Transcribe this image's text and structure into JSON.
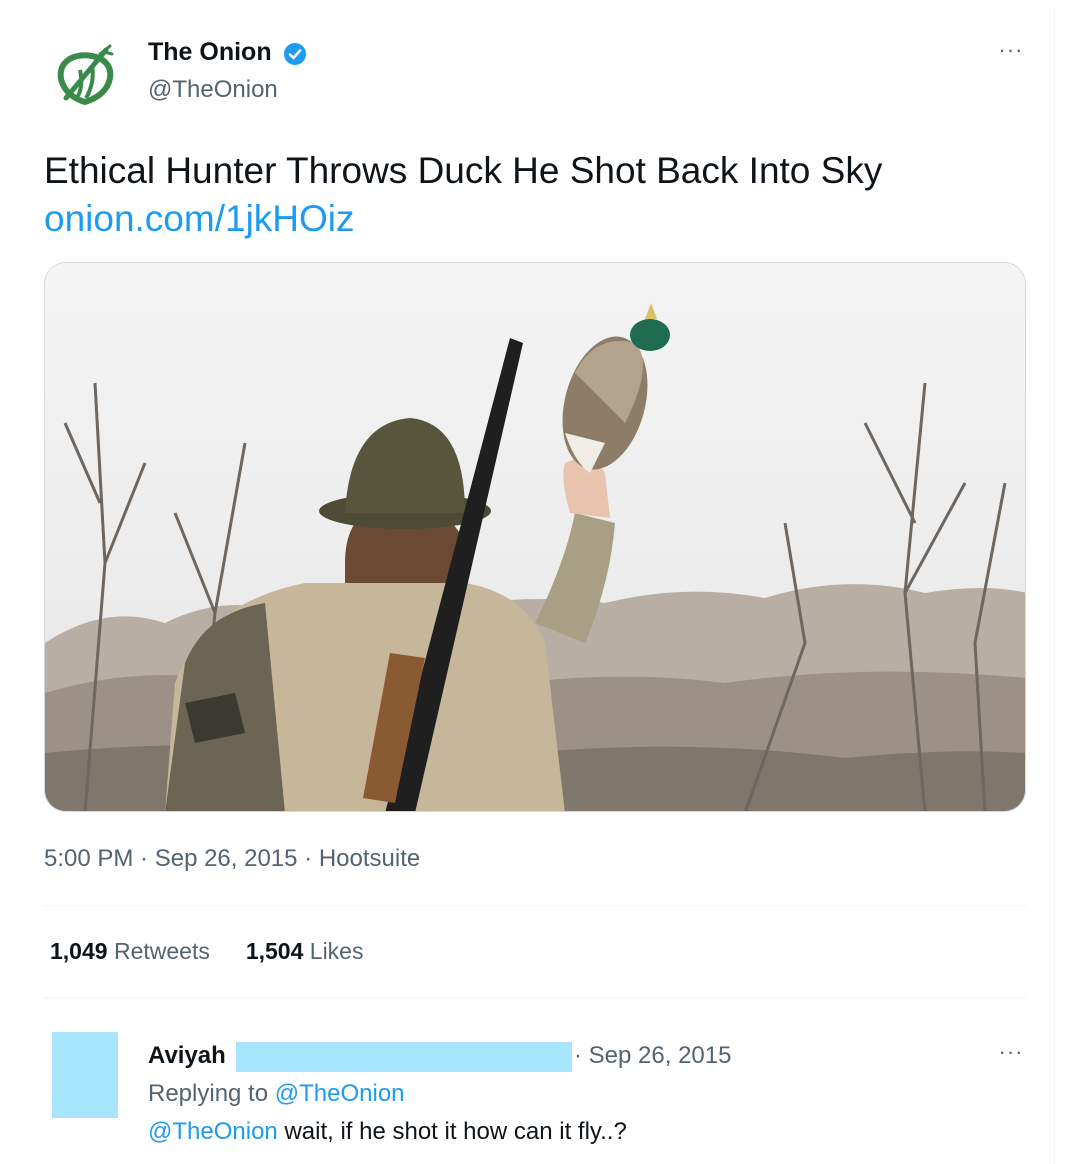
{
  "tweet": {
    "author_name": "The Onion",
    "author_handle": "@TheOnion",
    "text": "Ethical Hunter Throws Duck He Shot Back Into Sky",
    "link": "onion.com/1jkHOiz",
    "timestamp": "5:00 PM · Sep 26, 2015 · Hootsuite",
    "retweets_count": "1,049",
    "retweets_label": "Retweets",
    "likes_count": "1,504",
    "likes_label": "Likes",
    "more_label": "···"
  },
  "reply": {
    "author_name": "Aviyah",
    "date": "· Sep 26, 2015",
    "replying_to_label": "Replying to",
    "replying_to_handle": "@TheOnion",
    "mention": "@TheOnion",
    "body": "wait, if he shot it how can it fly..?",
    "more_label": "···"
  },
  "colors": {
    "link_blue": "#1d9bf0",
    "verified_blue": "#1d9bf0",
    "onion_green": "#3a8a4a",
    "redaction_blue": "#a6e5fb",
    "muted_text": "#536471"
  }
}
